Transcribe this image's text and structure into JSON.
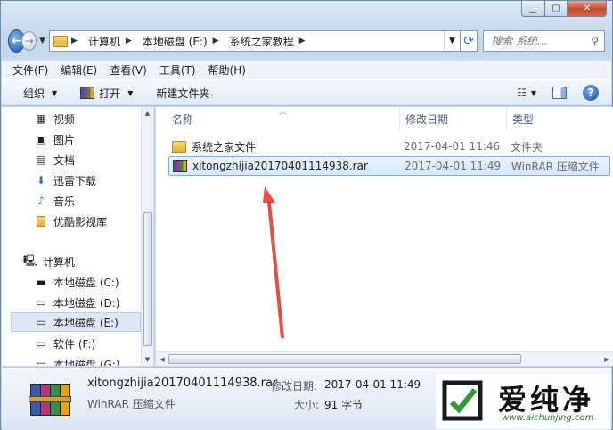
{
  "window": {
    "caption": {
      "minimize": "▁",
      "maximize": "▢",
      "close": "✕"
    }
  },
  "address": {
    "crumbs": [
      "计算机",
      "本地磁盘 (E:)",
      "系统之家教程"
    ],
    "search_placeholder": "搜索 系统..."
  },
  "menu": [
    "文件(F)",
    "编辑(E)",
    "查看(V)",
    "工具(T)",
    "帮助(H)"
  ],
  "toolbar": {
    "organize": "组织",
    "open": "打开",
    "new_folder": "新建文件夹"
  },
  "nav": {
    "items": [
      {
        "label": "视频",
        "icon": "video-icon"
      },
      {
        "label": "图片",
        "icon": "pictures-icon"
      },
      {
        "label": "文档",
        "icon": "documents-icon"
      },
      {
        "label": "迅雷下载",
        "icon": "download-folder-icon"
      },
      {
        "label": "音乐",
        "icon": "music-icon"
      },
      {
        "label": "优酷影视库",
        "icon": "folder-icon"
      },
      {
        "label": "计算机",
        "icon": "computer-icon"
      },
      {
        "label": "本地磁盘 (C:)",
        "icon": "system-drive-icon"
      },
      {
        "label": "本地磁盘 (D:)",
        "icon": "drive-icon"
      },
      {
        "label": "本地磁盘 (E:)",
        "icon": "drive-icon",
        "selected": true
      },
      {
        "label": "软件 (F:)",
        "icon": "drive-icon"
      },
      {
        "label": "本地磁盘 (G:)",
        "icon": "drive-icon"
      }
    ]
  },
  "columns": {
    "name": "名称",
    "modified": "修改日期",
    "type": "类型"
  },
  "files": [
    {
      "name": "系统之家文件",
      "modified": "2017-04-01 11:46",
      "type": "文件夹",
      "icon": "folder-icon"
    },
    {
      "name": "xitongzhijia20170401114938.rar",
      "modified": "2017-04-01 11:49",
      "type": "WinRAR 压缩文件",
      "icon": "winrar-icon",
      "selected": true
    }
  ],
  "details": {
    "name": "xitongzhijia20170401114938.rar",
    "type": "WinRAR 压缩文件",
    "modified_label": "修改日期:",
    "modified": "2017-04-01 11:49",
    "size_label": "大小:",
    "size": "91 字节"
  },
  "watermark": {
    "text": "爱纯净",
    "url": "www.aichunjing.com"
  },
  "colors": {
    "arrow": "#e0403a",
    "selection": "#d3e6fa",
    "watermark_green": "#2b7a2e"
  }
}
